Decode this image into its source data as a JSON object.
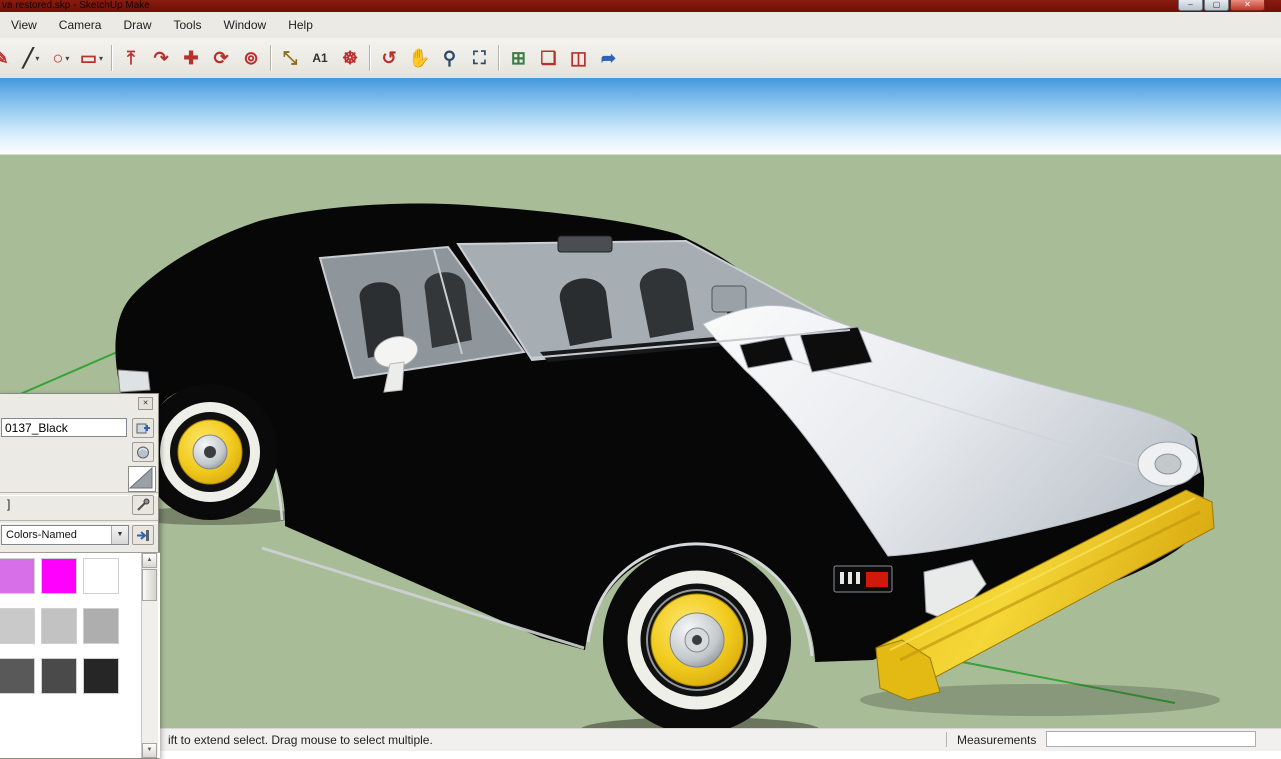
{
  "titlebar": {
    "title": "va restored.skp - SketchUp Make",
    "minimize_glyph": "–",
    "maximize_glyph": "▢",
    "close_glyph": "✕"
  },
  "menubar": {
    "items": [
      "View",
      "Camera",
      "Draw",
      "Tools",
      "Window",
      "Help"
    ]
  },
  "toolbar": {
    "tools": [
      {
        "name": "freehand-tool",
        "glyph": "✎",
        "color": "#b8312f"
      },
      {
        "name": "line-tool",
        "glyph": "╱",
        "color": "#333333",
        "dropdown": true
      },
      {
        "name": "circle-tool",
        "glyph": "○",
        "color": "#b8312f",
        "dropdown": true
      },
      {
        "name": "rectangle-tool",
        "glyph": "▭",
        "color": "#b8312f",
        "dropdown": true
      },
      {
        "name": "separator"
      },
      {
        "name": "push-pull-tool",
        "glyph": "⤒",
        "color": "#b8312f"
      },
      {
        "name": "follow-me-tool",
        "glyph": "↷",
        "color": "#b8312f"
      },
      {
        "name": "move-tool",
        "glyph": "✚",
        "color": "#b8312f"
      },
      {
        "name": "rotate-tool",
        "glyph": "⟳",
        "color": "#b8312f"
      },
      {
        "name": "offset-tool",
        "glyph": "⊚",
        "color": "#b8312f"
      },
      {
        "name": "separator"
      },
      {
        "name": "tape-measure-tool",
        "glyph": "⤡",
        "color": "#8a6d1c"
      },
      {
        "name": "text-tool",
        "glyph": "A1",
        "color": "#333333",
        "small": true
      },
      {
        "name": "paint-bucket-tool",
        "glyph": "☸",
        "color": "#b8312f"
      },
      {
        "name": "separator"
      },
      {
        "name": "orbit-tool",
        "glyph": "↺",
        "color": "#b8312f"
      },
      {
        "name": "pan-tool",
        "glyph": "✋",
        "color": "#b07d4e"
      },
      {
        "name": "zoom-tool",
        "glyph": "⚲",
        "color": "#2d4a66"
      },
      {
        "name": "zoom-extents-tool",
        "glyph": "⛶",
        "color": "#2d4a66"
      },
      {
        "name": "separator"
      },
      {
        "name": "views-tool",
        "glyph": "⊞",
        "color": "#3a7d44"
      },
      {
        "name": "shadows-tool",
        "glyph": "❏",
        "color": "#b8312f"
      },
      {
        "name": "section-plane-tool",
        "glyph": "◫",
        "color": "#b8312f"
      },
      {
        "name": "export-tool",
        "glyph": "➦",
        "color": "#2d62b8"
      }
    ]
  },
  "materials_panel": {
    "material_name": "0137_Black",
    "list_fragment": "]",
    "collection": "Colors-Named",
    "swatch_rows": [
      [
        "#d66fe8",
        "#ff00ff",
        "#ffffff"
      ],
      [
        "#c9c9c9",
        "#c2c2c2",
        "#aeaeae"
      ],
      [
        "#595959",
        "#4a4a4a",
        "#262626"
      ]
    ]
  },
  "statusbar": {
    "hint": "ift to extend select. Drag mouse to select multiple.",
    "measurements_label": "Measurements",
    "measurements_value": ""
  },
  "colors": {
    "ground": "#a9bc98",
    "sky_top": "#4598dd",
    "axis_green": "#37a337",
    "car_yellow": "#efc91d",
    "titlebar_red": "#7a150a"
  }
}
